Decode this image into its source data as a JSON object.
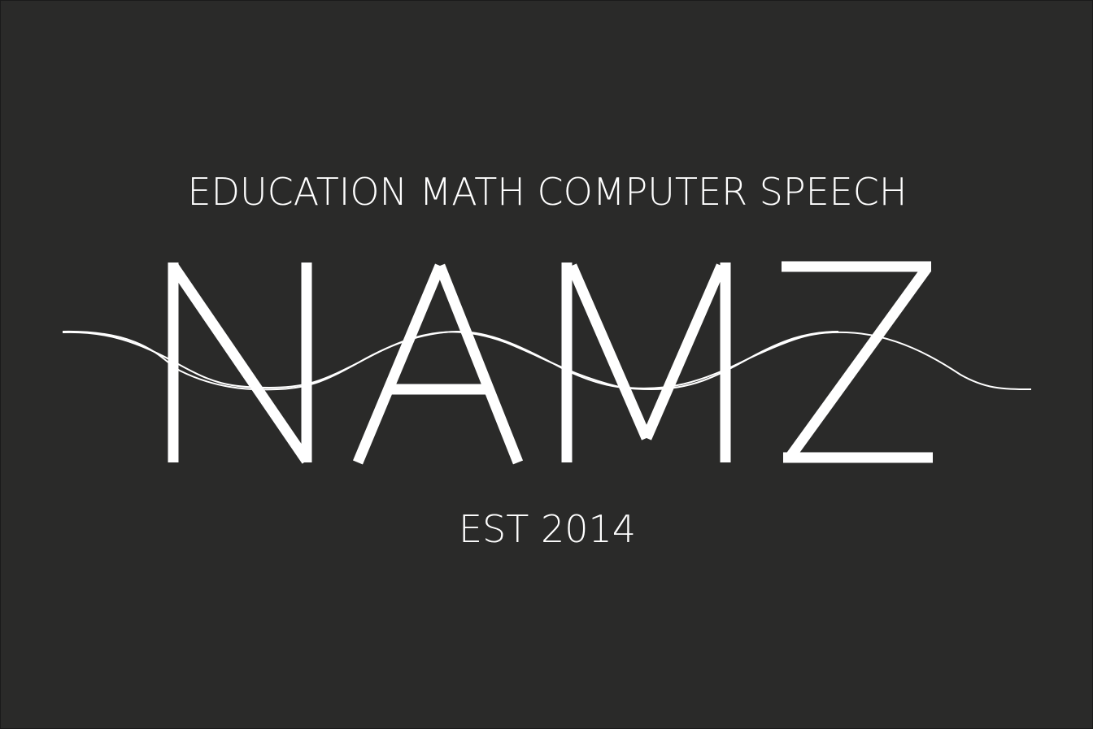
{
  "tagline": "EDUCATION MATH COMPUTER SPEECH",
  "logo_text": "NAMZ",
  "established": "EST 2014",
  "colors": {
    "background": "#2a2a29",
    "foreground": "#ffffff"
  }
}
